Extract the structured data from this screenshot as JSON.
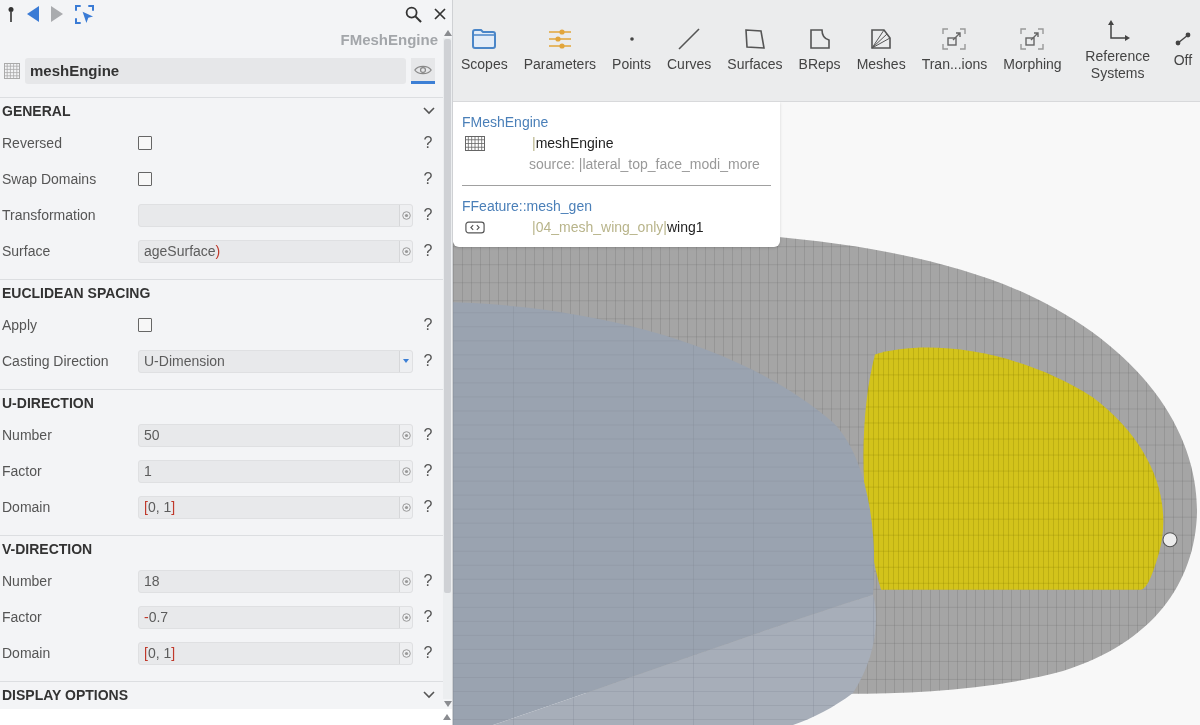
{
  "panel": {
    "nav_buttons": [
      {
        "kind": "pin",
        "disabled": false
      },
      {
        "kind": "back",
        "disabled": false
      },
      {
        "kind": "forward",
        "disabled": true
      },
      {
        "kind": "select",
        "disabled": false
      }
    ],
    "type_label": "FMeshEngine",
    "name_field": {
      "value": "meshEngine"
    },
    "visibility_toggle": {
      "on": true
    },
    "sections": [
      {
        "title": "GENERAL",
        "collapsible": true,
        "rows": [
          {
            "kind": "checkbox",
            "label": "Reversed",
            "checked": false,
            "help": "?"
          },
          {
            "kind": "checkbox",
            "label": "Swap Domains",
            "checked": false,
            "help": "?"
          },
          {
            "kind": "field",
            "label": "Transformation",
            "help": "?"
          },
          {
            "kind": "field",
            "label": "Surface",
            "value": "ageSurface)",
            "help": "?"
          }
        ]
      },
      {
        "title": "EUCLIDEAN SPACING",
        "collapsible": false,
        "rows": [
          {
            "kind": "checkbox",
            "label": "Apply",
            "checked": false,
            "help": "?"
          },
          {
            "kind": "dropdown",
            "label": "Casting Direction",
            "value": "U-Dimension",
            "help": "?"
          }
        ]
      },
      {
        "title": "U-DIRECTION",
        "collapsible": false,
        "rows": [
          {
            "kind": "field",
            "label": "Number",
            "value": "50",
            "help": "?"
          },
          {
            "kind": "field",
            "label": "Factor",
            "value": "1",
            "help": "?"
          },
          {
            "kind": "field",
            "label": "Domain",
            "value": "[0, 1]",
            "help": "?"
          }
        ]
      },
      {
        "title": "V-DIRECTION",
        "collapsible": false,
        "rows": [
          {
            "kind": "field",
            "label": "Number",
            "value": "18",
            "help": "?"
          },
          {
            "kind": "field",
            "label": "Factor",
            "value": "-0.7",
            "help": "?"
          },
          {
            "kind": "field",
            "label": "Domain",
            "value": "[0, 1]",
            "help": "?"
          }
        ]
      },
      {
        "title": "DISPLAY OPTIONS",
        "collapsible": true
      }
    ]
  },
  "toolbar": {
    "items": [
      {
        "label": "Scopes",
        "kind": "folder"
      },
      {
        "label": "Parameters",
        "kind": "sliders"
      },
      {
        "label": "Points",
        "kind": "point"
      },
      {
        "label": "Curves",
        "kind": "curve"
      },
      {
        "label": "Surfaces",
        "kind": "surface"
      },
      {
        "label": "BReps",
        "kind": "brep"
      },
      {
        "label": "Meshes",
        "kind": "mesh"
      },
      {
        "label": "Tran...ions",
        "kind": "transform"
      },
      {
        "label": "Morphing",
        "kind": "morph"
      },
      {
        "label": "Reference Systems",
        "kind": "axes"
      },
      {
        "label": "Off",
        "kind": "offset"
      }
    ]
  },
  "viewport": {
    "tooltip": {
      "entries": [
        {
          "type_name": "FMeshEngine",
          "kind": "mesh",
          "scope": "|",
          "name": "meshEngine",
          "detail": "source: |lateral_top_face_modi_more"
        },
        {
          "type_name": "FFeature::mesh_gen",
          "kind": "code",
          "scope": "|04_mesh_wing_only|",
          "name": "wing1"
        }
      ]
    }
  }
}
